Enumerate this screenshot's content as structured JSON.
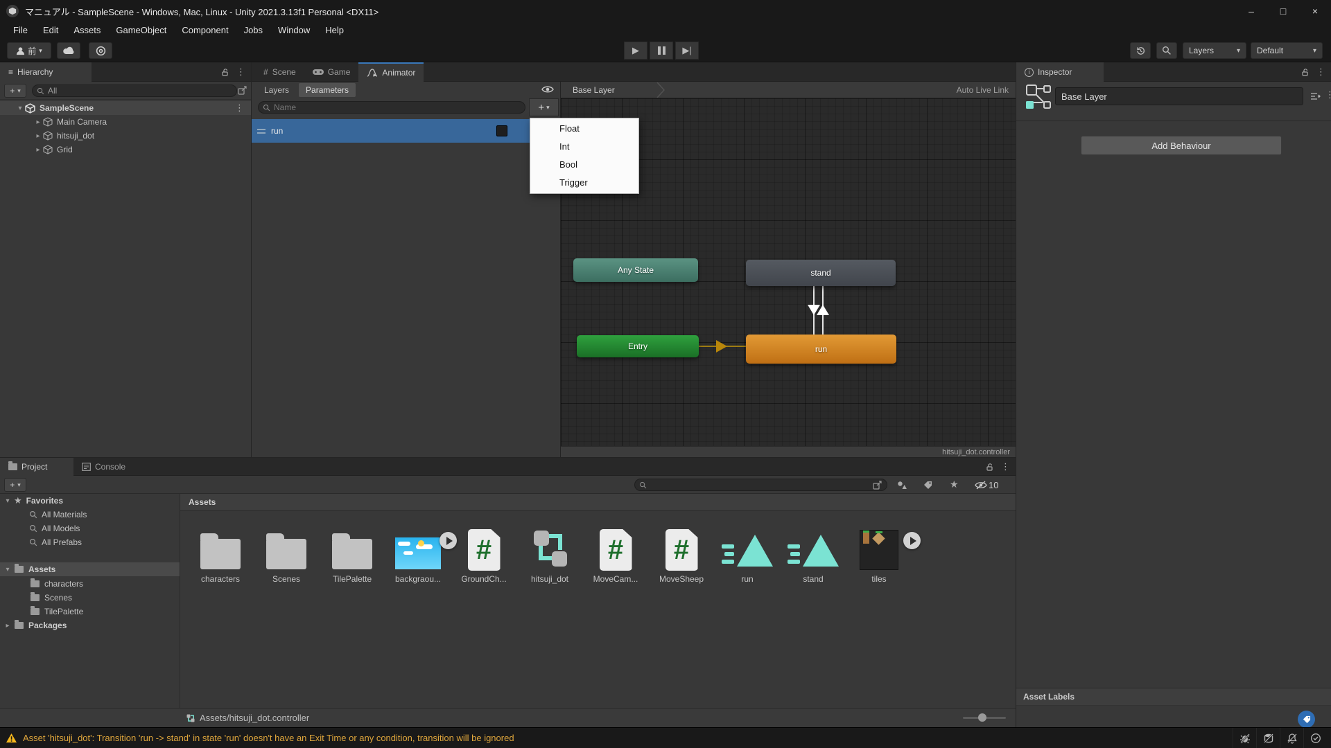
{
  "window": {
    "title": "マニュアル - SampleScene - Windows, Mac, Linux - Unity 2021.3.13f1 Personal <DX11>"
  },
  "menu": {
    "items": [
      "File",
      "Edit",
      "Assets",
      "GameObject",
      "Component",
      "Jobs",
      "Window",
      "Help"
    ]
  },
  "toolbar": {
    "account_label": "前",
    "layers_label": "Layers",
    "layout_label": "Default"
  },
  "hierarchy": {
    "tab_label": "Hierarchy",
    "search_value": "All",
    "scene_name": "SampleScene",
    "items": [
      "Main Camera",
      "hitsuji_dot",
      "Grid"
    ]
  },
  "animator": {
    "tab_scene": "Scene",
    "tab_game": "Game",
    "tab_animator": "Animator",
    "layers_tab": "Layers",
    "parameters_tab": "Parameters",
    "search_placeholder": "Name",
    "parameter_name": "run",
    "add_menu": [
      "Float",
      "Int",
      "Bool",
      "Trigger"
    ],
    "breadcrumb": "Base Layer",
    "auto_live_link": "Auto Live Link",
    "nodes": {
      "any_state": "Any State",
      "stand": "stand",
      "entry": "Entry",
      "run": "run"
    },
    "controller_label": "hitsuji_dot.controller"
  },
  "inspector": {
    "tab_label": "Inspector",
    "layer_name": "Base Layer",
    "add_behaviour_label": "Add Behaviour",
    "asset_labels_header": "Asset Labels"
  },
  "project": {
    "tab_project": "Project",
    "tab_console": "Console",
    "favorites_label": "Favorites",
    "favorites_items": [
      "All Materials",
      "All Models",
      "All Prefabs"
    ],
    "assets_label": "Assets",
    "assets_children": [
      "characters",
      "Scenes",
      "TilePalette"
    ],
    "packages_label": "Packages",
    "assets_header": "Assets",
    "hidden_count": "10",
    "grid_items": [
      {
        "label": "characters",
        "type": "folder"
      },
      {
        "label": "Scenes",
        "type": "folder"
      },
      {
        "label": "TilePalette",
        "type": "folder"
      },
      {
        "label": "backgraou...",
        "type": "image-sky"
      },
      {
        "label": "GroundCh...",
        "type": "script"
      },
      {
        "label": "hitsuji_dot",
        "type": "animator-controller"
      },
      {
        "label": "MoveCam...",
        "type": "script"
      },
      {
        "label": "MoveSheep",
        "type": "script"
      },
      {
        "label": "run",
        "type": "animation"
      },
      {
        "label": "stand",
        "type": "animation"
      },
      {
        "label": "tiles",
        "type": "image-tiles"
      }
    ],
    "footer_path": "Assets/hitsuji_dot.controller"
  },
  "status": {
    "warning": "Asset 'hitsuji_dot': Transition 'run -> stand' in state 'run' doesn't have an Exit Time or any condition, transition will be ignored"
  },
  "icons": {
    "minimize": "–",
    "maximize": "□",
    "close": "×",
    "kebab": "⋮",
    "hamburger": "≡",
    "dropdown": "▾",
    "disclosure_open": "▾",
    "disclosure_closed": "▸",
    "star": "★",
    "hash": "#",
    "play": "▶",
    "step_play": "▶|",
    "plus": "+",
    "info": "i"
  },
  "colors": {
    "selection_blue": "#38679a",
    "focused_tab_line": "#3a79bb",
    "node_any_state": "#4f8578",
    "node_stand": "#4a4e55",
    "node_entry": "#27933a",
    "node_run": "#d3821f",
    "warning_text": "#dfa63c",
    "asset_teal": "#7be3d3"
  }
}
